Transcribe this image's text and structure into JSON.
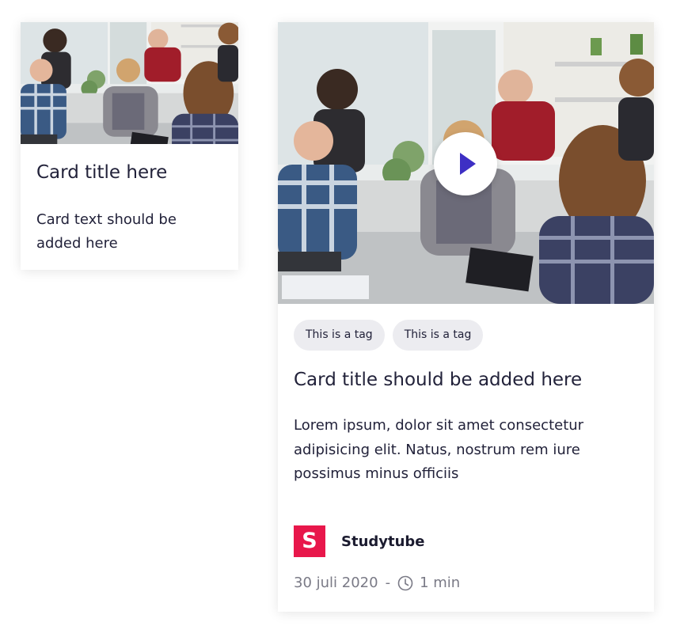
{
  "cards": [
    {
      "title": "Card title here",
      "text": "Card text should be added here",
      "image": "people-meeting-photo"
    },
    {
      "title": "Card title should be added here",
      "text": "Lorem ipsum, dolor sit amet consectetur adipisicing elit. Natus, nostrum rem iure possimus minus officiis",
      "image": "people-meeting-photo",
      "play_icon": "play-icon",
      "tags": [
        "This is a tag",
        "This is a tag"
      ],
      "provider": {
        "logo_letter": "S",
        "name": "Studytube",
        "logo_color": "#e8174b"
      },
      "date": "30 juli 2020",
      "separator": "-",
      "duration_icon": "clock-icon",
      "duration": "1 min"
    }
  ],
  "colors": {
    "play_accent": "#3d2fc4",
    "tag_background": "#ececf0",
    "meta_text": "#7a7a86"
  }
}
